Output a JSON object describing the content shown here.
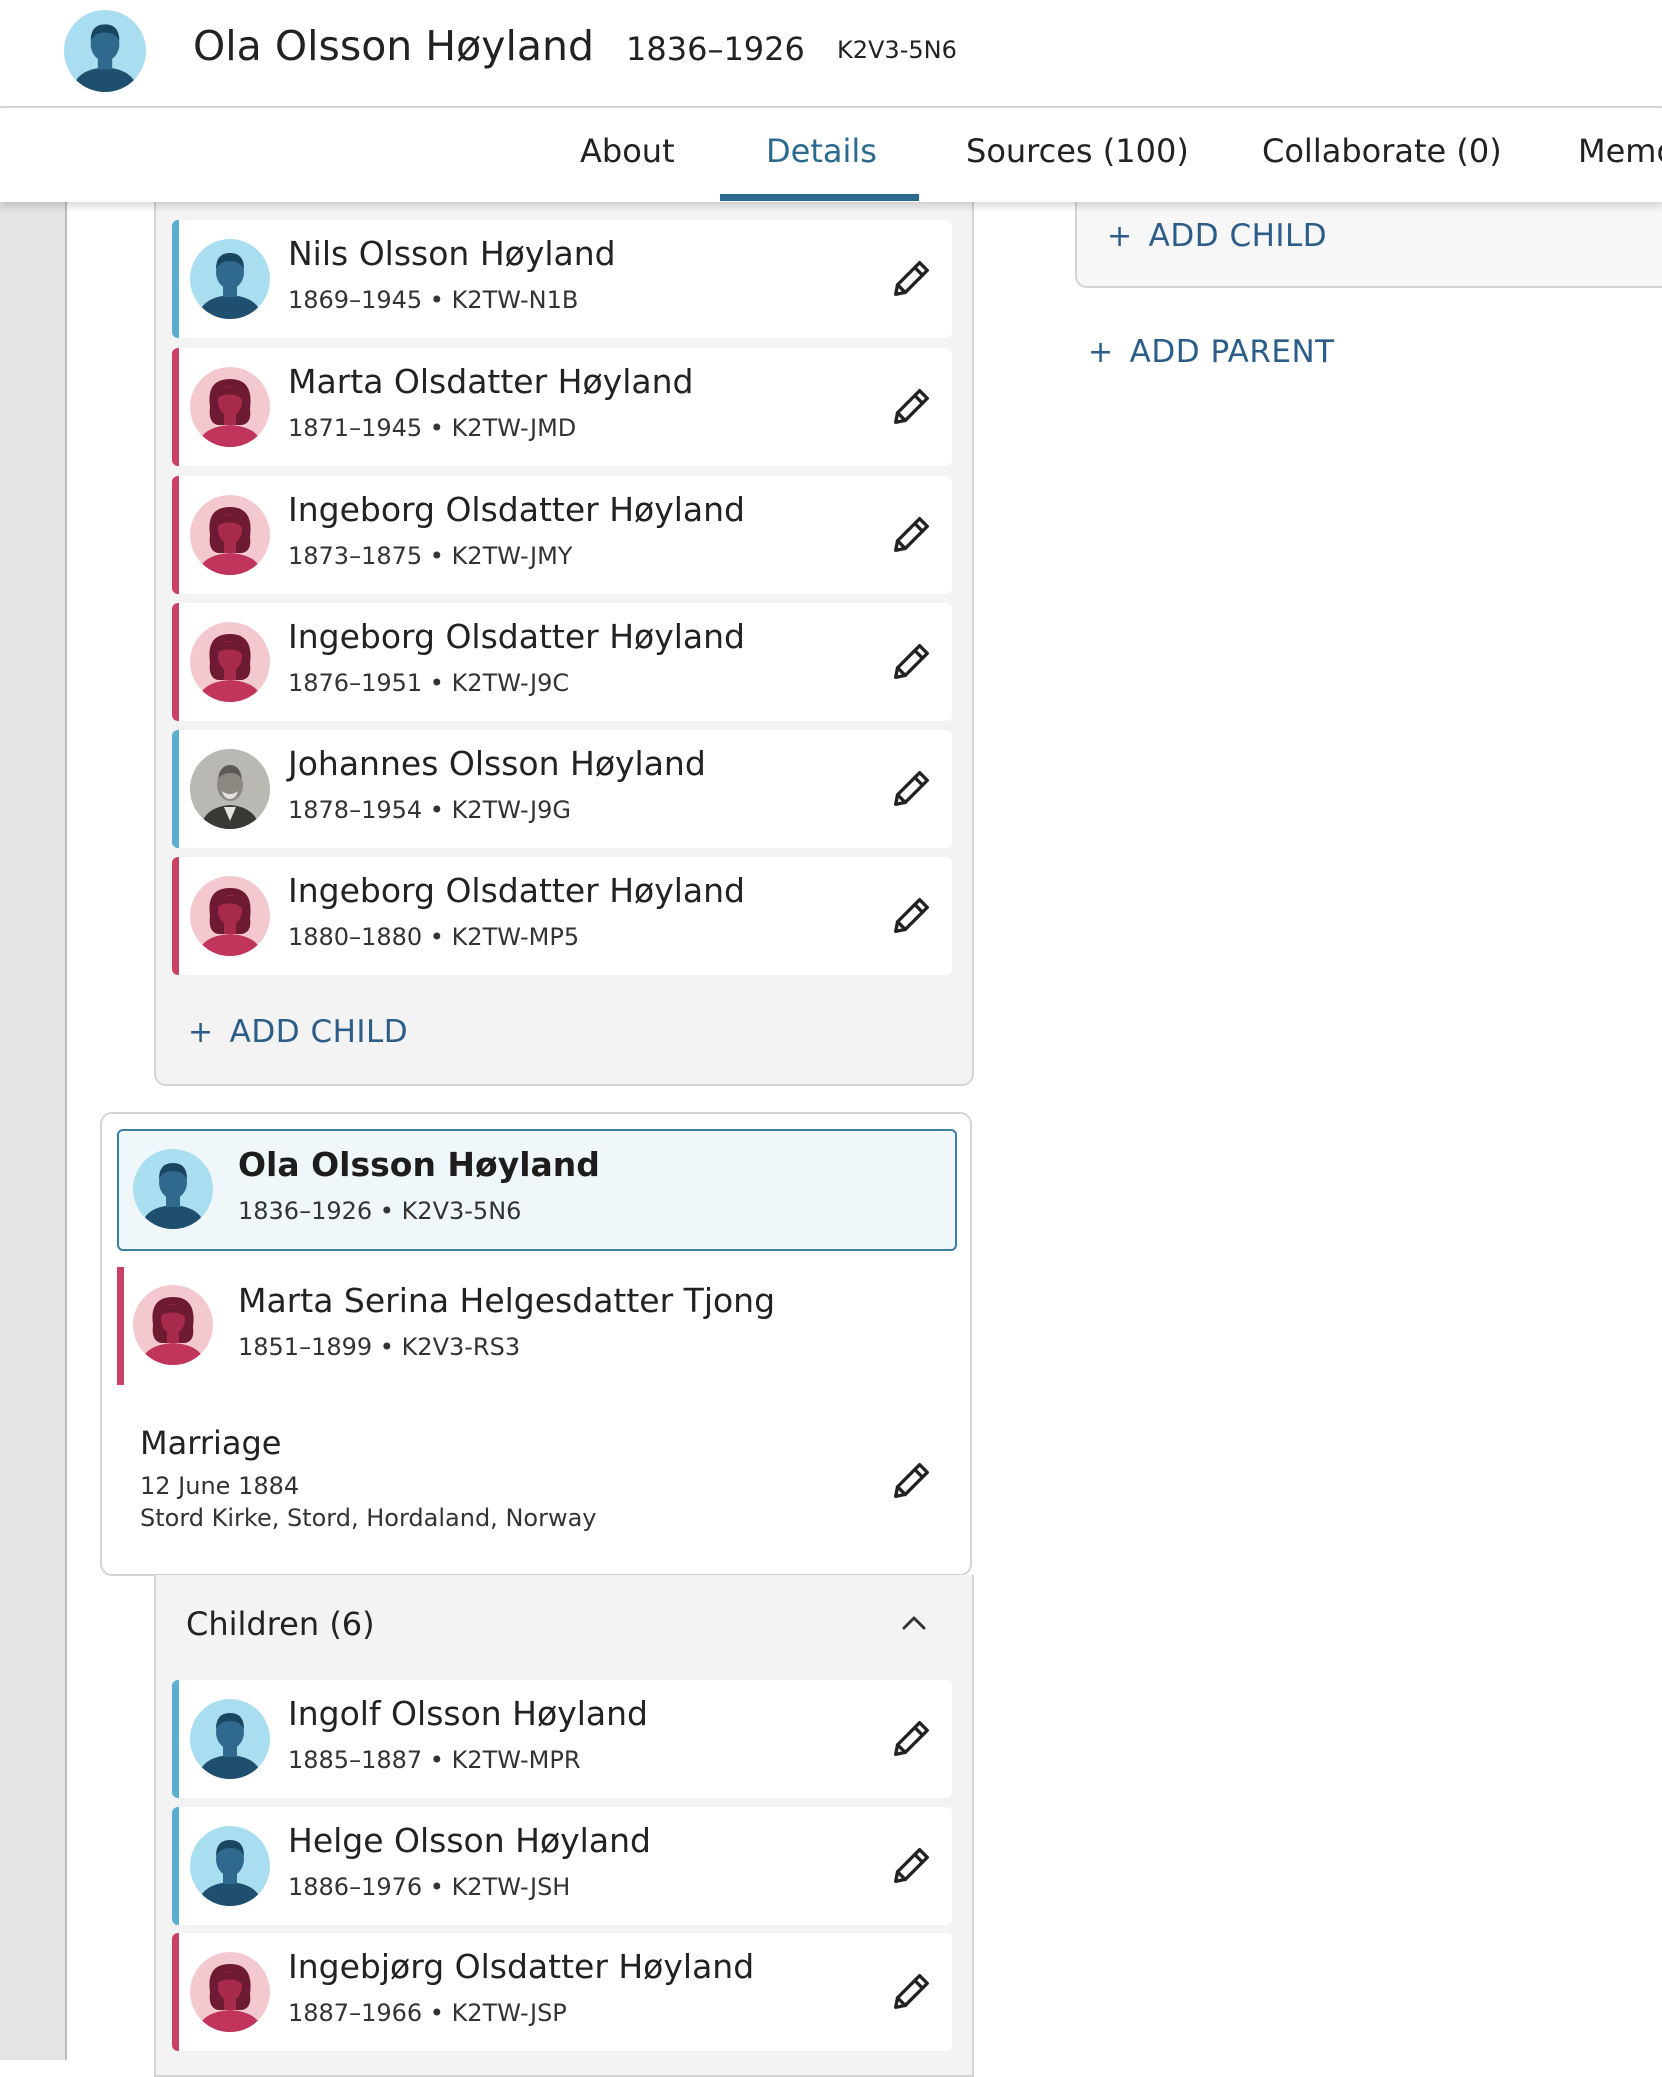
{
  "header": {
    "name": "Ola Olsson Høyland",
    "dates": "1836–1926",
    "pid": "K2V3-5N6"
  },
  "tabs": [
    {
      "label": "About"
    },
    {
      "label": "Details"
    },
    {
      "label": "Sources (100)"
    },
    {
      "label": "Collaborate (0)"
    },
    {
      "label": "Memo"
    }
  ],
  "active_tab": "Details",
  "family1": {
    "children": [
      {
        "name": "Nils Olsson Høyland",
        "info": "1869–1945 • K2TW-N1B",
        "gender": "male"
      },
      {
        "name": "Marta Olsdatter Høyland",
        "info": "1871–1945 • K2TW-JMD",
        "gender": "female"
      },
      {
        "name": "Ingeborg Olsdatter Høyland",
        "info": "1873–1875 • K2TW-JMY",
        "gender": "female"
      },
      {
        "name": "Ingeborg Olsdatter Høyland",
        "info": "1876–1951 • K2TW-J9C",
        "gender": "female"
      },
      {
        "name": "Johannes Olsson Høyland",
        "info": "1878–1954 • K2TW-J9G",
        "gender": "male"
      },
      {
        "name": "Ingeborg Olsdatter Høyland",
        "info": "1880–1880 • K2TW-MP5",
        "gender": "female"
      }
    ],
    "add_child": "ADD CHILD"
  },
  "family2": {
    "focus": {
      "name": "Ola Olsson Høyland",
      "info": "1836–1926 • K2V3-5N6"
    },
    "spouse": {
      "name": "Marta Serina Helgesdatter Tjong",
      "info": "1851–1899 • K2V3-RS3"
    },
    "marriage": {
      "title": "Marriage",
      "date": "12 June 1884",
      "place": "Stord Kirke, Stord, Hordaland, Norway"
    },
    "children_header": "Children (6)",
    "children": [
      {
        "name": "Ingolf Olsson Høyland",
        "info": "1885–1887 • K2TW-MPR",
        "gender": "male"
      },
      {
        "name": "Helge Olsson Høyland",
        "info": "1886–1976 • K2TW-JSH",
        "gender": "male"
      },
      {
        "name": "Ingebjørg Olsdatter Høyland",
        "info": "1887–1966 • K2TW-JSP",
        "gender": "female"
      }
    ]
  },
  "right": {
    "add_child": "ADD CHILD",
    "add_parent": "ADD PARENT"
  },
  "colors": {
    "accent": "#2b6a8d",
    "male": "#5aaed0",
    "female": "#c94266",
    "link": "#2b5d88"
  }
}
